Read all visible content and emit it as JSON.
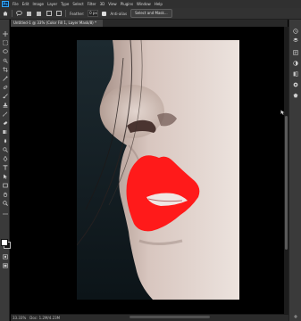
{
  "app": {
    "logo_text": "Ps",
    "menu": [
      "File",
      "Edit",
      "Image",
      "Layer",
      "Type",
      "Select",
      "Filter",
      "3D",
      "View",
      "Plugins",
      "Window",
      "Help"
    ]
  },
  "options": {
    "feather_label": "Feather:",
    "feather_value": "0 px",
    "antialias_label": "Anti-alias",
    "select_mask_label": "Select and Mask..."
  },
  "document": {
    "tab_title": "Untitled-1 @ 33% (Color Fill 1, Layer Mask/8) *"
  },
  "status": {
    "zoom": "33.33%",
    "doc_info": "Doc: 1.2M/4.23M"
  },
  "colors": {
    "lip_fill": "#ff1a1a",
    "accent": "#31a8ff",
    "foreground_swatch": "#ffffff",
    "background_swatch": "#111111"
  },
  "icons": {
    "toolbar": [
      "move-icon",
      "marquee-icon",
      "lasso-icon",
      "quick-select-icon",
      "crop-icon",
      "eyedropper-icon",
      "healing-brush-icon",
      "brush-icon",
      "clone-stamp-icon",
      "history-brush-icon",
      "eraser-icon",
      "gradient-icon",
      "blur-icon",
      "dodge-icon",
      "pen-icon",
      "type-icon",
      "path-select-icon",
      "rectangle-icon",
      "hand-icon",
      "zoom-icon"
    ],
    "panel": [
      "history-icon",
      "layers-icon",
      "properties-icon",
      "adjustments-icon",
      "libraries-icon",
      "channels-icon",
      "paths-icon"
    ]
  }
}
